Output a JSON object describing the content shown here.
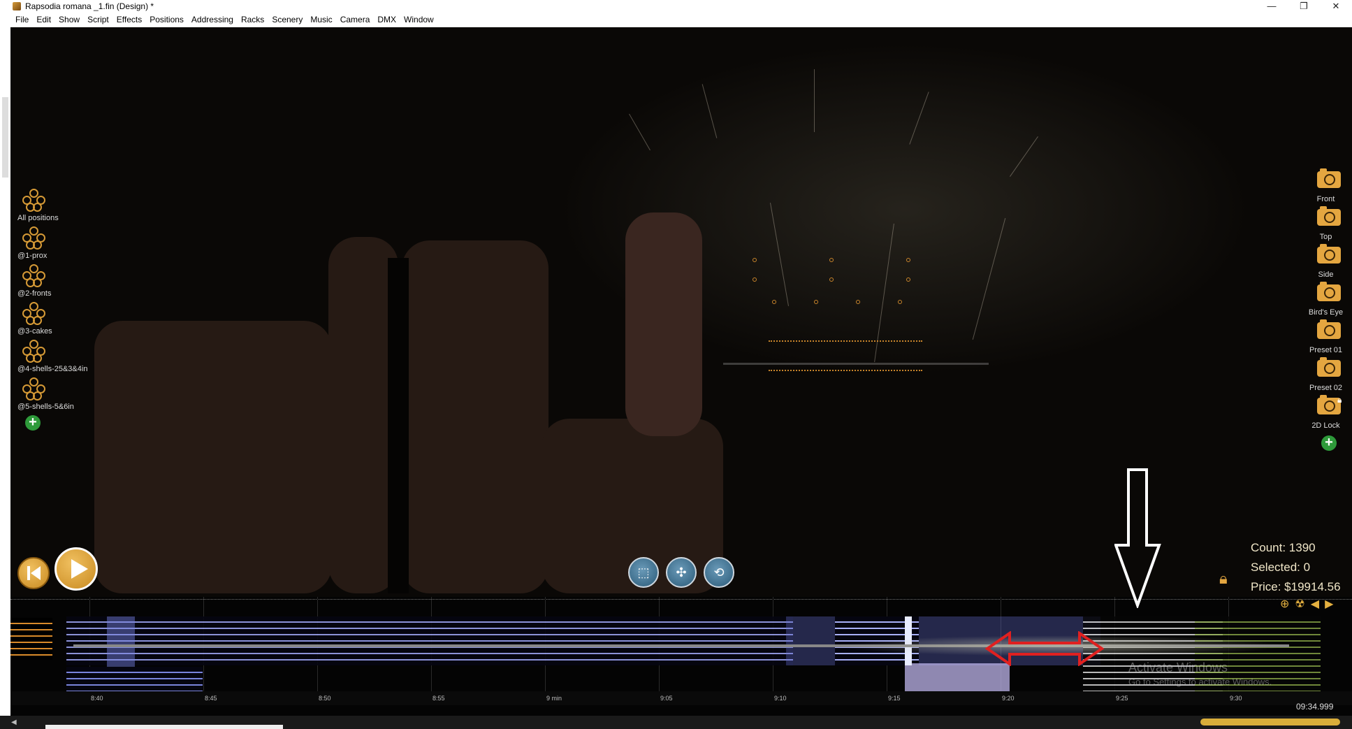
{
  "window": {
    "title": "Rapsodia romana _1.fin (Design) *",
    "controls": [
      "—",
      "❐",
      "✕"
    ]
  },
  "menu": [
    "File",
    "Edit",
    "Show",
    "Script",
    "Effects",
    "Positions",
    "Addressing",
    "Racks",
    "Scenery",
    "Music",
    "Camera",
    "DMX",
    "Window"
  ],
  "positions": [
    "All positions",
    "@1-prox",
    "@2-fronts",
    "@3-cakes",
    "@4-shells-25&3&4in",
    "@5-shells-5&6in"
  ],
  "cameras": [
    "Front",
    "Top",
    "Side",
    "Bird's Eye",
    "Preset 01",
    "Preset 02",
    "2D Lock"
  ],
  "stats": {
    "count": "Count: 1390",
    "selected": "Selected: 0",
    "price": "Price: $19914.56"
  },
  "timeline": {
    "ticks": [
      "8:40",
      "8:45",
      "8:50",
      "8:55",
      "9 min",
      "9:05",
      "9:10",
      "9:15",
      "9:20",
      "9:25",
      "9:30"
    ],
    "time_readout": "09:34.999"
  },
  "watermark": {
    "line1": "Activate Windows",
    "line2": "Go to Settings to activate Windows."
  },
  "colors": {
    "accent": "#e4a640",
    "track": "#8a94e8",
    "annotation_red": "#e02020"
  }
}
